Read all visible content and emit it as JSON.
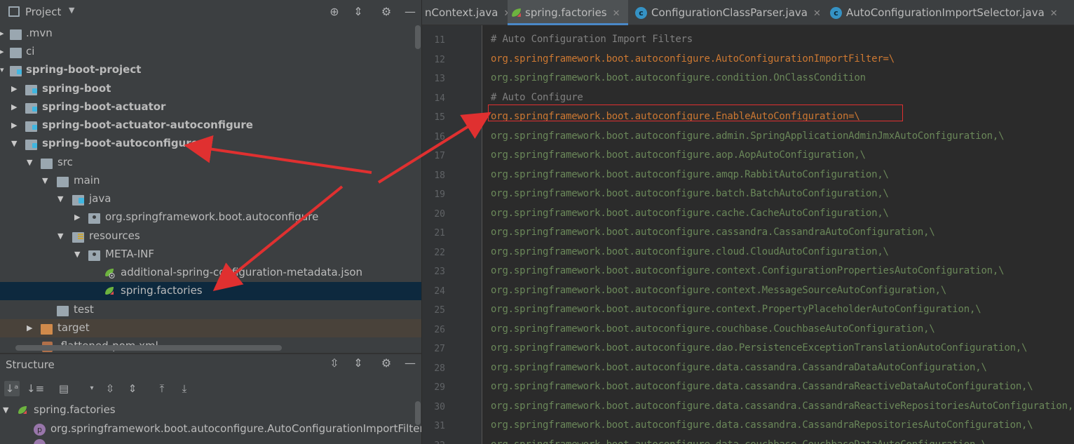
{
  "project_panel": {
    "title": "Project",
    "tree": [
      {
        "label": ".mvn",
        "type": "folder"
      },
      {
        "label": "ci",
        "type": "folder"
      },
      {
        "label": "spring-boot-project",
        "type": "module"
      },
      {
        "label": "spring-boot",
        "type": "module"
      },
      {
        "label": "spring-boot-actuator",
        "type": "module"
      },
      {
        "label": "spring-boot-actuator-autoconfigure",
        "type": "module"
      },
      {
        "label": "spring-boot-autoconfigure",
        "type": "module"
      },
      {
        "label": "src",
        "type": "folder"
      },
      {
        "label": "main",
        "type": "folder"
      },
      {
        "label": "java",
        "type": "source-folder"
      },
      {
        "label": "org.springframework.boot.autoconfigure",
        "type": "package"
      },
      {
        "label": "resources",
        "type": "resources-folder"
      },
      {
        "label": "META-INF",
        "type": "package"
      },
      {
        "label": "additional-spring-configuration-metadata.json",
        "type": "json-file"
      },
      {
        "label": "spring.factories",
        "type": "spring-file"
      },
      {
        "label": "test",
        "type": "folder"
      },
      {
        "label": "target",
        "type": "excluded-folder"
      },
      {
        "label": ".flattened-pom.xml",
        "type": "xml-file"
      }
    ]
  },
  "structure_panel": {
    "title": "Structure",
    "root": "spring.factories",
    "items": [
      {
        "label": "org.springframework.boot.autoconfigure.AutoConfigurationImportFilter",
        "badge": "p"
      }
    ]
  },
  "editor": {
    "tabs": [
      {
        "label": "nContext.java"
      },
      {
        "label": "spring.factories"
      },
      {
        "label": "ConfigurationClassParser.java"
      },
      {
        "label": "AutoConfigurationImportSelector.java"
      }
    ],
    "lines": [
      {
        "num": "11",
        "kind": "comment",
        "key": "# Auto Configuration Import Filters",
        "value": ""
      },
      {
        "num": "12",
        "kind": "key",
        "key": "org.springframework.boot.autoconfigure.AutoConfigurationImportFilter=\\",
        "value": ""
      },
      {
        "num": "13",
        "kind": "value",
        "key": "",
        "value": "org.springframework.boot.autoconfigure.condition.OnClassCondition"
      },
      {
        "num": "14",
        "kind": "comment",
        "key": "# Auto Configure",
        "value": ""
      },
      {
        "num": "15",
        "kind": "key",
        "key": "org.springframework.boot.autoconfigure.EnableAutoConfiguration=\\",
        "value": ""
      },
      {
        "num": "16",
        "kind": "value",
        "key": "",
        "value": "org.springframework.boot.autoconfigure.admin.SpringApplicationAdminJmxAutoConfiguration,\\"
      },
      {
        "num": "17",
        "kind": "value",
        "key": "",
        "value": "org.springframework.boot.autoconfigure.aop.AopAutoConfiguration,\\"
      },
      {
        "num": "18",
        "kind": "value",
        "key": "",
        "value": "org.springframework.boot.autoconfigure.amqp.RabbitAutoConfiguration,\\"
      },
      {
        "num": "19",
        "kind": "value",
        "key": "",
        "value": "org.springframework.boot.autoconfigure.batch.BatchAutoConfiguration,\\"
      },
      {
        "num": "20",
        "kind": "value",
        "key": "",
        "value": "org.springframework.boot.autoconfigure.cache.CacheAutoConfiguration,\\"
      },
      {
        "num": "21",
        "kind": "value",
        "key": "",
        "value": "org.springframework.boot.autoconfigure.cassandra.CassandraAutoConfiguration,\\"
      },
      {
        "num": "22",
        "kind": "value",
        "key": "",
        "value": "org.springframework.boot.autoconfigure.cloud.CloudAutoConfiguration,\\"
      },
      {
        "num": "23",
        "kind": "value",
        "key": "",
        "value": "org.springframework.boot.autoconfigure.context.ConfigurationPropertiesAutoConfiguration,\\"
      },
      {
        "num": "24",
        "kind": "value",
        "key": "",
        "value": "org.springframework.boot.autoconfigure.context.MessageSourceAutoConfiguration,\\"
      },
      {
        "num": "25",
        "kind": "value",
        "key": "",
        "value": "org.springframework.boot.autoconfigure.context.PropertyPlaceholderAutoConfiguration,\\"
      },
      {
        "num": "26",
        "kind": "value",
        "key": "",
        "value": "org.springframework.boot.autoconfigure.couchbase.CouchbaseAutoConfiguration,\\"
      },
      {
        "num": "27",
        "kind": "value",
        "key": "",
        "value": "org.springframework.boot.autoconfigure.dao.PersistenceExceptionTranslationAutoConfiguration,\\"
      },
      {
        "num": "28",
        "kind": "value",
        "key": "",
        "value": "org.springframework.boot.autoconfigure.data.cassandra.CassandraDataAutoConfiguration,\\"
      },
      {
        "num": "29",
        "kind": "value",
        "key": "",
        "value": "org.springframework.boot.autoconfigure.data.cassandra.CassandraReactiveDataAutoConfiguration,\\"
      },
      {
        "num": "30",
        "kind": "value",
        "key": "",
        "value": "org.springframework.boot.autoconfigure.data.cassandra.CassandraReactiveRepositoriesAutoConfiguration,\\"
      },
      {
        "num": "31",
        "kind": "value",
        "key": "",
        "value": "org.springframework.boot.autoconfigure.data.cassandra.CassandraRepositoriesAutoConfiguration,\\"
      },
      {
        "num": "32",
        "kind": "value",
        "key": "",
        "value": "org.springframework.boot.autoconfigure.data.couchbase.CouchbaseDataAutoConfiguration,\\"
      }
    ]
  },
  "colors": {
    "panel_bg": "#3c3f41",
    "editor_bg": "#2b2b2b",
    "selection": "#0d293e",
    "properties_key": "#cc7832",
    "properties_value": "#6a8759",
    "comment": "#808080",
    "annotation_red": "#e03030"
  }
}
